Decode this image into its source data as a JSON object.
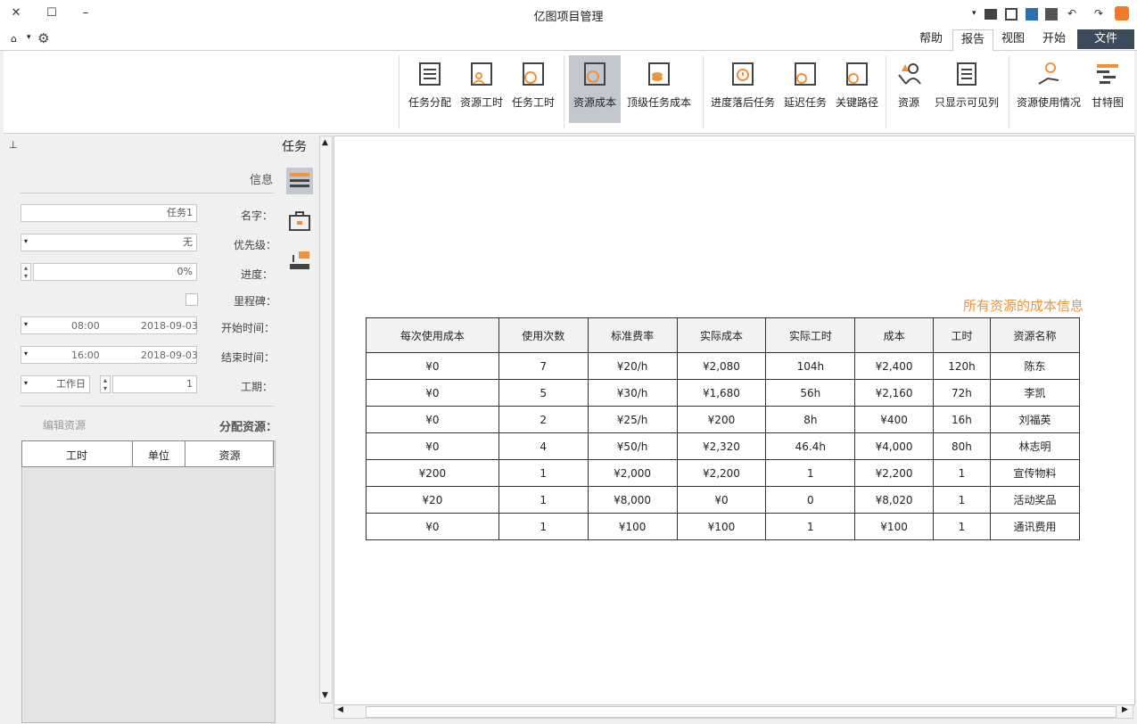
{
  "app": {
    "title": "亿图项目管理"
  },
  "colors": {
    "accent": "#f0923a",
    "file_tab": "#3b4a5c",
    "active_button": "#c3c8d0"
  },
  "menu": {
    "tabs": [
      {
        "label": "文件"
      },
      {
        "label": "开始"
      },
      {
        "label": "视图"
      },
      {
        "label": "报告"
      },
      {
        "label": "帮助"
      }
    ],
    "active": "报告"
  },
  "ribbon": {
    "buttons": [
      {
        "label": "甘特图",
        "icon": "gantt-icon"
      },
      {
        "label": "资源使用情况",
        "icon": "resource-usage-icon"
      },
      {
        "label": "只显示可见列",
        "icon": "visible-columns-icon"
      },
      {
        "label": "资源",
        "icon": "resource-icon"
      },
      {
        "label": "关键路径",
        "icon": "critical-path-icon"
      },
      {
        "label": "延迟任务",
        "icon": "delayed-task-icon"
      },
      {
        "label": "进度落后任务",
        "icon": "behind-schedule-icon"
      },
      {
        "label": "顶级任务成本",
        "icon": "top-task-cost-icon"
      },
      {
        "label": "资源成本",
        "icon": "resource-cost-icon"
      },
      {
        "label": "任务工时",
        "icon": "task-work-icon"
      },
      {
        "label": "资源工时",
        "icon": "resource-work-icon"
      },
      {
        "label": "任务分配",
        "icon": "task-assign-icon"
      }
    ]
  },
  "taskpanel": {
    "header": "任务",
    "section_info": "信息",
    "name_label": "名字：",
    "name_value": "任务1",
    "priority_label": "优先级：",
    "priority_value": "无",
    "progress_label": "进度：",
    "progress_value": "0%",
    "milestone_label": "里程碑：",
    "start_label": "开始时间：",
    "start_date": "2018-09-03",
    "start_time": "08:00",
    "end_label": "结束时间：",
    "end_date": "2018-09-03",
    "end_time": "16:00",
    "duration_label": "工期：",
    "duration_value": "1",
    "duration_unit": "工作日",
    "assign_label": "分配资源：",
    "edit_resource": "编辑资源",
    "assign_headers": [
      "资源",
      "单位",
      "工时"
    ]
  },
  "report": {
    "title": "所有资源的成本信息",
    "headers": [
      "资源名称",
      "工时",
      "成本",
      "实际工时",
      "实际成本",
      "标准费率",
      "使用次数",
      "每次使用成本"
    ],
    "rows": [
      [
        "陈东",
        "120h",
        "¥2,400",
        "104h",
        "¥2,080",
        "¥20/h",
        "7",
        "¥0"
      ],
      [
        "李凯",
        "72h",
        "¥2,160",
        "56h",
        "¥1,680",
        "¥30/h",
        "5",
        "¥0"
      ],
      [
        "刘福英",
        "16h",
        "¥400",
        "8h",
        "¥200",
        "¥25/h",
        "2",
        "¥0"
      ],
      [
        "林志明",
        "80h",
        "¥4,000",
        "46.4h",
        "¥2,320",
        "¥50/h",
        "4",
        "¥0"
      ],
      [
        "宣传物料",
        "1",
        "¥2,200",
        "1",
        "¥2,200",
        "¥2,000",
        "1",
        "¥200"
      ],
      [
        "活动奖品",
        "1",
        "¥8,020",
        "0",
        "¥0",
        "¥8,000",
        "1",
        "¥20"
      ],
      [
        "通讯费用",
        "1",
        "¥100",
        "1",
        "¥100",
        "¥100",
        "1",
        "¥0"
      ]
    ]
  }
}
